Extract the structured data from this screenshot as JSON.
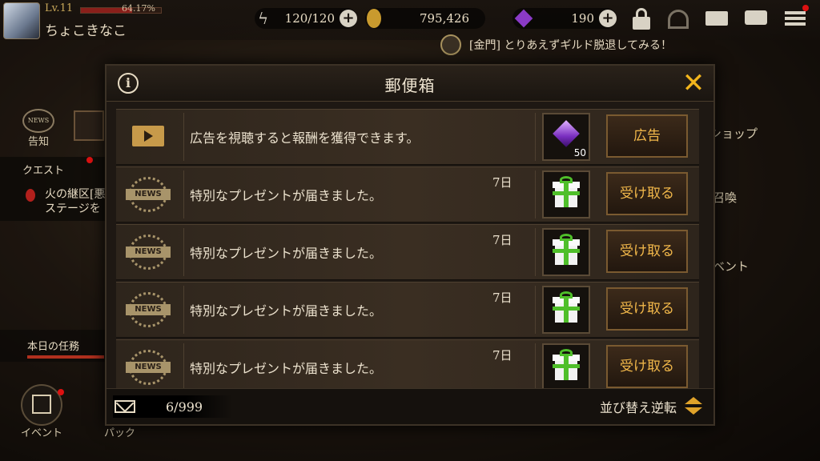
{
  "player": {
    "level": "Lv.11",
    "xp_percent": "64.17%",
    "xp_fraction": 0.6417,
    "name": "ちょこきなこ"
  },
  "resources": {
    "stamina": "120/120",
    "gold": "795,426",
    "gems": "190"
  },
  "ticker": {
    "text": "[金門] とりあえずギルド脱退してみる！"
  },
  "background_menus": {
    "news_label": "告知",
    "quest_label": "クエスト",
    "quest_text_1": "火の継区[悪",
    "quest_text_2": "ステージを",
    "daily_mission": "本日の任務",
    "event_label": "イベント",
    "pack_label": "パック",
    "right_shop": "ショップ",
    "right_summon": "召喚",
    "right_event": "ベント"
  },
  "mailbox": {
    "title": "郵便箱",
    "info_icon_text": "i",
    "close_icon_text": "✕",
    "news_icon_text": "NEWS",
    "rows": [
      {
        "icon": "video-icon",
        "text": "広告を視聴すると報酬を獲得できます。",
        "days": "",
        "reward": "gem-icon",
        "reward_qty": "50",
        "action": "広告"
      },
      {
        "icon": "news-icon",
        "text": "特別なプレゼントが届きました。",
        "days": "7日",
        "reward": "gift-icon",
        "reward_qty": "",
        "action": "受け取る"
      },
      {
        "icon": "news-icon",
        "text": "特別なプレゼントが届きました。",
        "days": "7日",
        "reward": "gift-icon",
        "reward_qty": "",
        "action": "受け取る"
      },
      {
        "icon": "news-icon",
        "text": "特別なプレゼントが届きました。",
        "days": "7日",
        "reward": "gift-icon",
        "reward_qty": "",
        "action": "受け取る"
      },
      {
        "icon": "news-icon",
        "text": "特別なプレゼントが届きました。",
        "days": "7日",
        "reward": "gift-icon",
        "reward_qty": "",
        "action": "受け取る"
      }
    ],
    "count": "6/999",
    "sort_label": "並び替え逆転"
  },
  "colors": {
    "accent": "#f2b51c",
    "button_text": "#f2b84a",
    "gift_ribbon": "#4fbf2a"
  }
}
